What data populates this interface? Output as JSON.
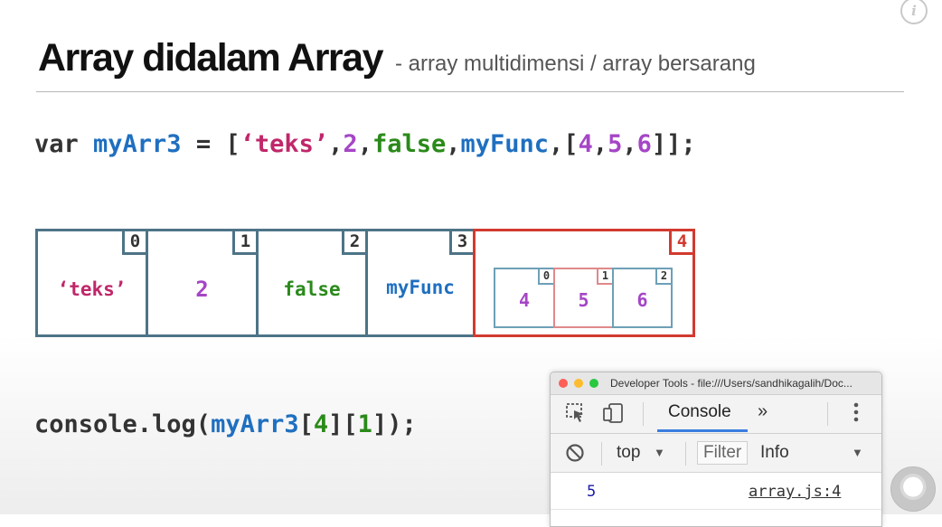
{
  "header": {
    "title": "Array didalam Array",
    "subtitle": "- array multidimensi / array bersarang",
    "info_icon": "info-icon"
  },
  "code_line_1": {
    "tokens": [
      {
        "text": "var ",
        "kind": "keyword"
      },
      {
        "text": "myArr3",
        "kind": "name"
      },
      {
        "text": " = [",
        "kind": "punct"
      },
      {
        "text": "‘teks’",
        "kind": "string"
      },
      {
        "text": ",",
        "kind": "punct"
      },
      {
        "text": "2",
        "kind": "number"
      },
      {
        "text": ",",
        "kind": "punct"
      },
      {
        "text": "false",
        "kind": "boolean"
      },
      {
        "text": ",",
        "kind": "punct"
      },
      {
        "text": "myFunc",
        "kind": "function"
      },
      {
        "text": ",[",
        "kind": "punct"
      },
      {
        "text": "4",
        "kind": "number"
      },
      {
        "text": ",",
        "kind": "punct"
      },
      {
        "text": "5",
        "kind": "number"
      },
      {
        "text": ",",
        "kind": "punct"
      },
      {
        "text": "6",
        "kind": "number"
      },
      {
        "text": "]];",
        "kind": "punct"
      }
    ]
  },
  "array_diagram": {
    "cells": [
      {
        "index": "0",
        "value": "‘teks’",
        "color": "#c0276a"
      },
      {
        "index": "1",
        "value": "2",
        "color": "#a546c6"
      },
      {
        "index": "2",
        "value": "false",
        "color": "#2a8a1a"
      },
      {
        "index": "3",
        "value": "myFunc",
        "color": "#1f6fc0"
      },
      {
        "index": "4",
        "value": "",
        "color": "#d23a2f"
      }
    ],
    "inner_cells": [
      {
        "index": "0",
        "value": "4"
      },
      {
        "index": "1",
        "value": "5"
      },
      {
        "index": "2",
        "value": "6"
      }
    ],
    "outer_border_color": "#4d7487",
    "highlight_color": "#d23a2f",
    "inner_border_color": "#6da0b7",
    "inner_highlight_color": "#e0898a"
  },
  "code_line_2": {
    "tokens": [
      {
        "text": "console.log(",
        "kind": "keyword"
      },
      {
        "text": "myArr3",
        "kind": "name"
      },
      {
        "text": "[",
        "kind": "punct"
      },
      {
        "text": "4",
        "kind": "number2"
      },
      {
        "text": "][",
        "kind": "punct"
      },
      {
        "text": "1",
        "kind": "number2"
      },
      {
        "text": "]);",
        "kind": "punct"
      }
    ]
  },
  "devtools": {
    "window_title": "Developer Tools - file:///Users/sandhikagalih/Doc...",
    "tab_label": "Console",
    "more_tabs": "»",
    "context": "top",
    "filter_placeholder": "Filter",
    "level": "Info",
    "log_value": "5",
    "log_source": "array.js:4",
    "accent_color": "#3b7ee0"
  }
}
